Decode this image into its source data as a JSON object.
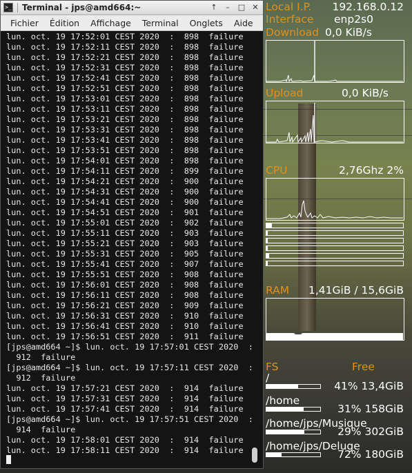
{
  "terminal": {
    "title": "Terminal - jps@amd664:~",
    "menu": [
      "Fichier",
      "Édition",
      "Affichage",
      "Terminal",
      "Onglets",
      "Aide"
    ],
    "lines": [
      "lun. oct. 19 17:52:01 CEST 2020  :  898  failure",
      "lun. oct. 19 17:52:11 CEST 2020  :  898  failure",
      "lun. oct. 19 17:52:21 CEST 2020  :  898  failure",
      "lun. oct. 19 17:52:31 CEST 2020  :  898  failure",
      "lun. oct. 19 17:52:41 CEST 2020  :  898  failure",
      "lun. oct. 19 17:52:51 CEST 2020  :  898  failure",
      "lun. oct. 19 17:53:01 CEST 2020  :  898  failure",
      "lun. oct. 19 17:53:11 CEST 2020  :  898  failure",
      "lun. oct. 19 17:53:21 CEST 2020  :  898  failure",
      "lun. oct. 19 17:53:31 CEST 2020  :  898  failure",
      "lun. oct. 19 17:53:41 CEST 2020  :  898  failure",
      "lun. oct. 19 17:53:51 CEST 2020  :  898  failure",
      "lun. oct. 19 17:54:01 CEST 2020  :  898  failure",
      "lun. oct. 19 17:54:11 CEST 2020  :  899  failure",
      "lun. oct. 19 17:54:21 CEST 2020  :  900  failure",
      "lun. oct. 19 17:54:31 CEST 2020  :  900  failure",
      "lun. oct. 19 17:54:41 CEST 2020  :  900  failure",
      "lun. oct. 19 17:54:51 CEST 2020  :  901  failure",
      "lun. oct. 19 17:55:01 CEST 2020  :  902  failure",
      "lun. oct. 19 17:55:11 CEST 2020  :  903  failure",
      "lun. oct. 19 17:55:21 CEST 2020  :  903  failure",
      "lun. oct. 19 17:55:31 CEST 2020  :  905  failure",
      "lun. oct. 19 17:55:41 CEST 2020  :  907  failure",
      "lun. oct. 19 17:55:51 CEST 2020  :  908  failure",
      "lun. oct. 19 17:56:01 CEST 2020  :  908  failure",
      "lun. oct. 19 17:56:11 CEST 2020  :  908  failure",
      "lun. oct. 19 17:56:21 CEST 2020  :  909  failure",
      "lun. oct. 19 17:56:31 CEST 2020  :  910  failure",
      "lun. oct. 19 17:56:41 CEST 2020  :  910  failure",
      "lun. oct. 19 17:56:51 CEST 2020  :  911  failure",
      "[jps@amd664 ~]$ lun. oct. 19 17:57:01 CEST 2020  :",
      "  912  failure",
      "[jps@amd664 ~]$ lun. oct. 19 17:57:11 CEST 2020  :",
      "  912  failure",
      "lun. oct. 19 17:57:21 CEST 2020  :  914  failure",
      "lun. oct. 19 17:57:31 CEST 2020  :  914  failure",
      "lun. oct. 19 17:57:41 CEST 2020  :  914  failure",
      "[jps@amd664 ~]$ lun. oct. 19 17:57:51 CEST 2020  :",
      "  914  failure",
      "lun. oct. 19 17:58:01 CEST 2020  :  914  failure",
      "lun. oct. 19 17:58:11 CEST 2020  :  914  failure"
    ]
  },
  "conky": {
    "local_ip_label": "Local I.P.",
    "local_ip": "192.168.0.12",
    "interface_label": "Interface",
    "interface": "enp2s0",
    "download_label": "Download",
    "download": "0,0 KiB/s",
    "upload_label": "Upload",
    "upload": "0,0 KiB/s",
    "cpu_label": "CPU",
    "cpu": "2,76Ghz 2%",
    "cpu_core_usage": [
      0.04,
      0.01,
      0.01,
      0.01,
      0.02,
      0.01
    ],
    "ram_label": "RAM",
    "ram": "1,41GiB / 15,6GiB",
    "fs_label": "FS",
    "free_label": "Free",
    "filesystems": [
      {
        "mount": "/",
        "used_fraction": 0.59,
        "free": "41% 13,4GiB"
      },
      {
        "mount": "/home",
        "used_fraction": 0.69,
        "free": "31% 158GiB"
      },
      {
        "mount": "/home/jps/Musique",
        "used_fraction": 0.71,
        "free": "29% 302GiB"
      },
      {
        "mount": "/home/jps/Deluge",
        "used_fraction": 0.28,
        "free": "72% 180GiB"
      }
    ],
    "label_color": "#e0901e"
  }
}
